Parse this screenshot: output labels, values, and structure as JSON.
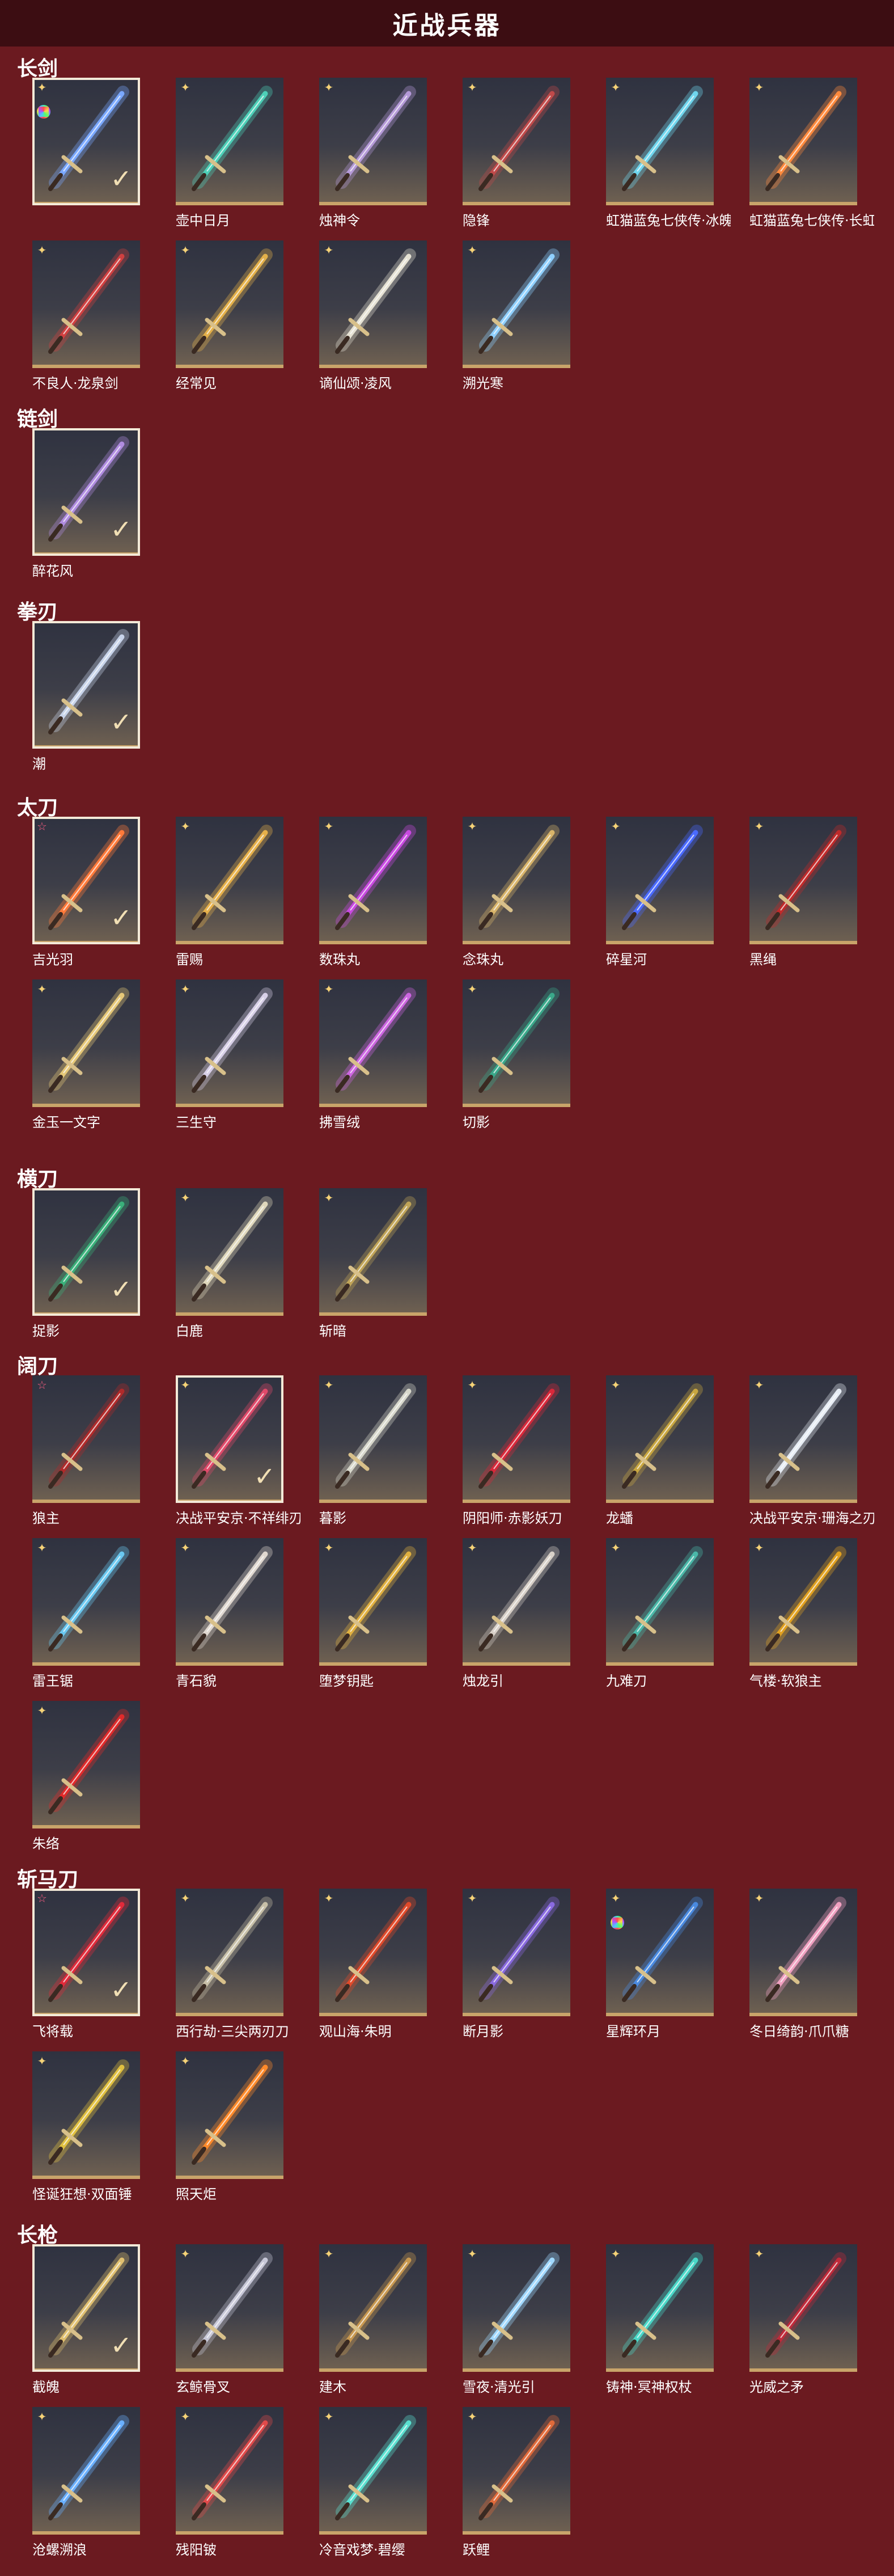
{
  "page": {
    "title": "近战兵器"
  },
  "sections": [
    {
      "title": "长剑",
      "items": [
        {
          "name": "",
          "badge": "rainbow",
          "selected": true,
          "color": "#7aa8ff"
        },
        {
          "name": "壶中日月",
          "badge": "gold",
          "selected": false,
          "color": "#4dd0b8"
        },
        {
          "name": "烛神令",
          "badge": "gold",
          "selected": false,
          "color": "#b59ad8"
        },
        {
          "name": "隐锋",
          "badge": "gold",
          "selected": false,
          "color": "#c04a4a"
        },
        {
          "name": "虹猫蓝兔七侠传·冰魄剑",
          "badge": "gold",
          "selected": false,
          "color": "#6fd6ee"
        },
        {
          "name": "虹猫蓝兔七侠传·长虹剑",
          "badge": "gold",
          "selected": false,
          "color": "#ff8a3d"
        },
        {
          "name": "不良人·龙泉剑",
          "badge": "gold",
          "selected": false,
          "color": "#d04040"
        },
        {
          "name": "经常见",
          "badge": "gold",
          "selected": false,
          "color": "#e3b04a"
        },
        {
          "name": "谪仙颂·凌风",
          "badge": "gold",
          "selected": false,
          "color": "#e6e2d4"
        },
        {
          "name": "溯光寒",
          "badge": "gold",
          "selected": false,
          "color": "#8fd0ff"
        }
      ]
    },
    {
      "title": "链剑",
      "items": [
        {
          "name": "醉花风",
          "badge": "",
          "selected": true,
          "color": "#b08ce0"
        }
      ]
    },
    {
      "title": "拳刃",
      "items": [
        {
          "name": "潮",
          "badge": "",
          "selected": true,
          "color": "#c8d4ea"
        }
      ]
    },
    {
      "title": "太刀",
      "items": [
        {
          "name": "吉光羽",
          "badge": "pink",
          "selected": true,
          "color": "#ff7a3a"
        },
        {
          "name": "雷赐",
          "badge": "gold",
          "selected": false,
          "color": "#e6b04a"
        },
        {
          "name": "数珠丸",
          "badge": "gold",
          "selected": false,
          "color": "#c84ae0"
        },
        {
          "name": "念珠丸",
          "badge": "gold",
          "selected": false,
          "color": "#d8b46a"
        },
        {
          "name": "碎星河",
          "badge": "gold",
          "selected": false,
          "color": "#4a6aff"
        },
        {
          "name": "黑绳",
          "badge": "gold",
          "selected": false,
          "color": "#c02a2a"
        },
        {
          "name": "金玉一文字",
          "badge": "gold",
          "selected": false,
          "color": "#e6c878"
        },
        {
          "name": "三生守",
          "badge": "gold",
          "selected": false,
          "color": "#d8d0e8"
        },
        {
          "name": "拂雪绒",
          "badge": "gold",
          "selected": false,
          "color": "#cc66e0"
        },
        {
          "name": "切影",
          "badge": "gold",
          "selected": false,
          "color": "#3aa88a"
        }
      ]
    },
    {
      "title": "横刀",
      "items": [
        {
          "name": "捉影",
          "badge": "",
          "selected": true,
          "color": "#3ab07a"
        },
        {
          "name": "白鹿",
          "badge": "gold",
          "selected": false,
          "color": "#e0d8bc"
        },
        {
          "name": "斩暗",
          "badge": "gold",
          "selected": false,
          "color": "#c0a458"
        }
      ]
    },
    {
      "title": "阔刀",
      "items": [
        {
          "name": "狼主",
          "badge": "pink",
          "selected": false,
          "color": "#b02a2a"
        },
        {
          "name": "决战平安京·不祥绯刃",
          "badge": "gold",
          "selected": true,
          "color": "#e04a6a"
        },
        {
          "name": "暮影",
          "badge": "gold",
          "selected": false,
          "color": "#d8d8cc"
        },
        {
          "name": "阴阳师·赤影妖刀",
          "badge": "gold",
          "selected": false,
          "color": "#d8283a"
        },
        {
          "name": "龙蟠",
          "badge": "gold",
          "selected": false,
          "color": "#c8a640"
        },
        {
          "name": "决战平安京·珊海之刃",
          "badge": "gold",
          "selected": false,
          "color": "#e6ecf4"
        },
        {
          "name": "雷王锯",
          "badge": "gold",
          "selected": false,
          "color": "#6ac8f0"
        },
        {
          "name": "青石貌",
          "badge": "gold",
          "selected": false,
          "color": "#e0d8d0"
        },
        {
          "name": "堕梦钥匙",
          "badge": "gold",
          "selected": false,
          "color": "#e0b040"
        },
        {
          "name": "烛龙引",
          "badge": "gold",
          "selected": false,
          "color": "#d8d0c8"
        },
        {
          "name": "九难刀",
          "badge": "gold",
          "selected": false,
          "color": "#4ab8a8"
        },
        {
          "name": "气楼·软狼主",
          "badge": "gold",
          "selected": false,
          "color": "#e0a020"
        },
        {
          "name": "朱络",
          "badge": "gold",
          "selected": false,
          "color": "#e02a2a"
        }
      ]
    },
    {
      "title": "斩马刀",
      "items": [
        {
          "name": "飞将载",
          "badge": "pink",
          "selected": true,
          "color": "#e02a3a"
        },
        {
          "name": "西行劫·三尖两刃刀",
          "badge": "gold",
          "selected": false,
          "color": "#c8c0a8"
        },
        {
          "name": "观山海·朱明",
          "badge": "gold",
          "selected": false,
          "color": "#e04a2a"
        },
        {
          "name": "断月影",
          "badge": "gold",
          "selected": false,
          "color": "#8a6ae0"
        },
        {
          "name": "星辉环月",
          "badge": "rainbow",
          "selected": false,
          "color": "#4a8ae0"
        },
        {
          "name": "冬日绮韵·爪爪糖",
          "badge": "gold",
          "selected": false,
          "color": "#f0a0c0"
        },
        {
          "name": "怪诞狂想·双面锤",
          "badge": "gold",
          "selected": false,
          "color": "#e0c040"
        },
        {
          "name": "照天炬",
          "badge": "gold",
          "selected": false,
          "color": "#ff8a2a"
        }
      ]
    },
    {
      "title": "长枪",
      "items": [
        {
          "name": "截魄",
          "badge": "",
          "selected": true,
          "color": "#e0c070"
        },
        {
          "name": "玄鲸骨叉",
          "badge": "gold",
          "selected": false,
          "color": "#c8c8d8"
        },
        {
          "name": "建木",
          "badge": "gold",
          "selected": false,
          "color": "#c89850"
        },
        {
          "name": "雪夜·清光引",
          "badge": "gold",
          "selected": false,
          "color": "#a0d8ff"
        },
        {
          "name": "铸神·冥神权杖",
          "badge": "gold",
          "selected": false,
          "color": "#4ad8c8"
        },
        {
          "name": "光威之矛",
          "badge": "gold",
          "selected": false,
          "color": "#c02a3a"
        },
        {
          "name": "沧螺溯浪",
          "badge": "gold",
          "selected": false,
          "color": "#6ab0ff"
        },
        {
          "name": "残阳铍",
          "badge": "gold",
          "selected": false,
          "color": "#e04a4a"
        },
        {
          "name": "冷音戏梦·碧缨",
          "badge": "gold",
          "selected": false,
          "color": "#5ae0d0"
        },
        {
          "name": "跃鲤",
          "badge": "gold",
          "selected": false,
          "color": "#e06a3a"
        }
      ]
    }
  ]
}
